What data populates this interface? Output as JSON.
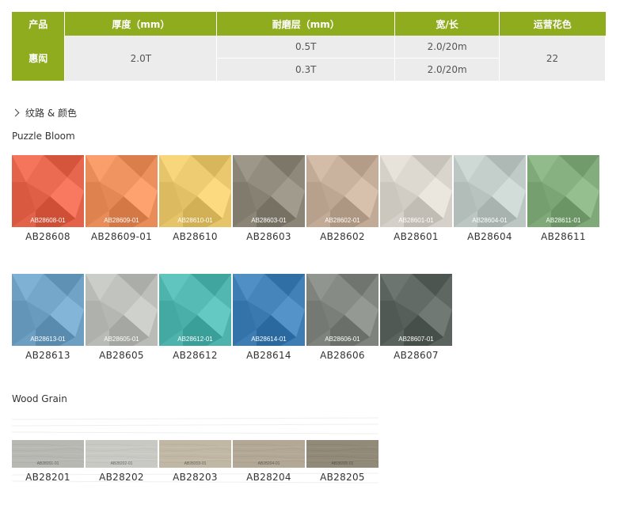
{
  "spec_table": {
    "headers": [
      "产品",
      "厚度（mm）",
      "耐磨层（mm）",
      "宽/长",
      "运营花色"
    ],
    "product": "惠闳",
    "thickness": "2.0T",
    "rows": [
      {
        "wear": "0.5T",
        "size": "2.0/20m"
      },
      {
        "wear": "0.3T",
        "size": "2.0/20m"
      }
    ],
    "colors_count": "22"
  },
  "section_title": "纹路 & 颜色",
  "groups": [
    {
      "title": "Puzzle Bloom",
      "rows": [
        [
          {
            "code": "AB28608-01",
            "name": "AB28608",
            "color": "#e2624a"
          },
          {
            "code": "AB28609-01",
            "name": "AB28609-01",
            "color": "#e88d5a"
          },
          {
            "code": "AB28610-01",
            "name": "AB28610",
            "color": "#e6c46a"
          },
          {
            "code": "AB28603-01",
            "name": "AB28603",
            "color": "#8b8578"
          },
          {
            "code": "AB28602-01",
            "name": "AB28602",
            "color": "#c2ab96"
          },
          {
            "code": "AB28601-01",
            "name": "AB28601",
            "color": "#d6d1c8"
          },
          {
            "code": "AB28604-01",
            "name": "AB28604",
            "color": "#bcc7c4"
          },
          {
            "code": "AB28611-01",
            "name": "AB28611",
            "color": "#7fa978"
          }
        ],
        [
          {
            "code": "AB28613-01",
            "name": "AB28613",
            "color": "#6c9fc2"
          },
          {
            "code": "AB28605-01",
            "name": "AB28605",
            "color": "#b9bbb6"
          },
          {
            "code": "AB28612-01",
            "name": "AB28612",
            "color": "#4fb3ad"
          },
          {
            "code": "AB28614-01",
            "name": "AB28614",
            "color": "#3d7db4"
          },
          {
            "code": "AB28606-01",
            "name": "AB28606",
            "color": "#7e837e"
          },
          {
            "code": "AB28607-01",
            "name": "AB28607",
            "color": "#5b635f"
          }
        ]
      ]
    },
    {
      "title": "Wood Grain",
      "rows": [
        [
          {
            "code": "AB28201-01",
            "name": "AB28201",
            "color": "#b7b8b1"
          },
          {
            "code": "AB28202-01",
            "name": "AB28202",
            "color": "#c9c9c4"
          },
          {
            "code": "AB28203-01",
            "name": "AB28203",
            "color": "#c1b7a5"
          },
          {
            "code": "AB28204-01",
            "name": "AB28204",
            "color": "#b2a895"
          },
          {
            "code": "AB28205-01",
            "name": "AB28205",
            "color": "#918a79"
          }
        ]
      ]
    }
  ],
  "colors": {
    "header_green": "#8fac1f",
    "cell_gray": "#ececec"
  }
}
